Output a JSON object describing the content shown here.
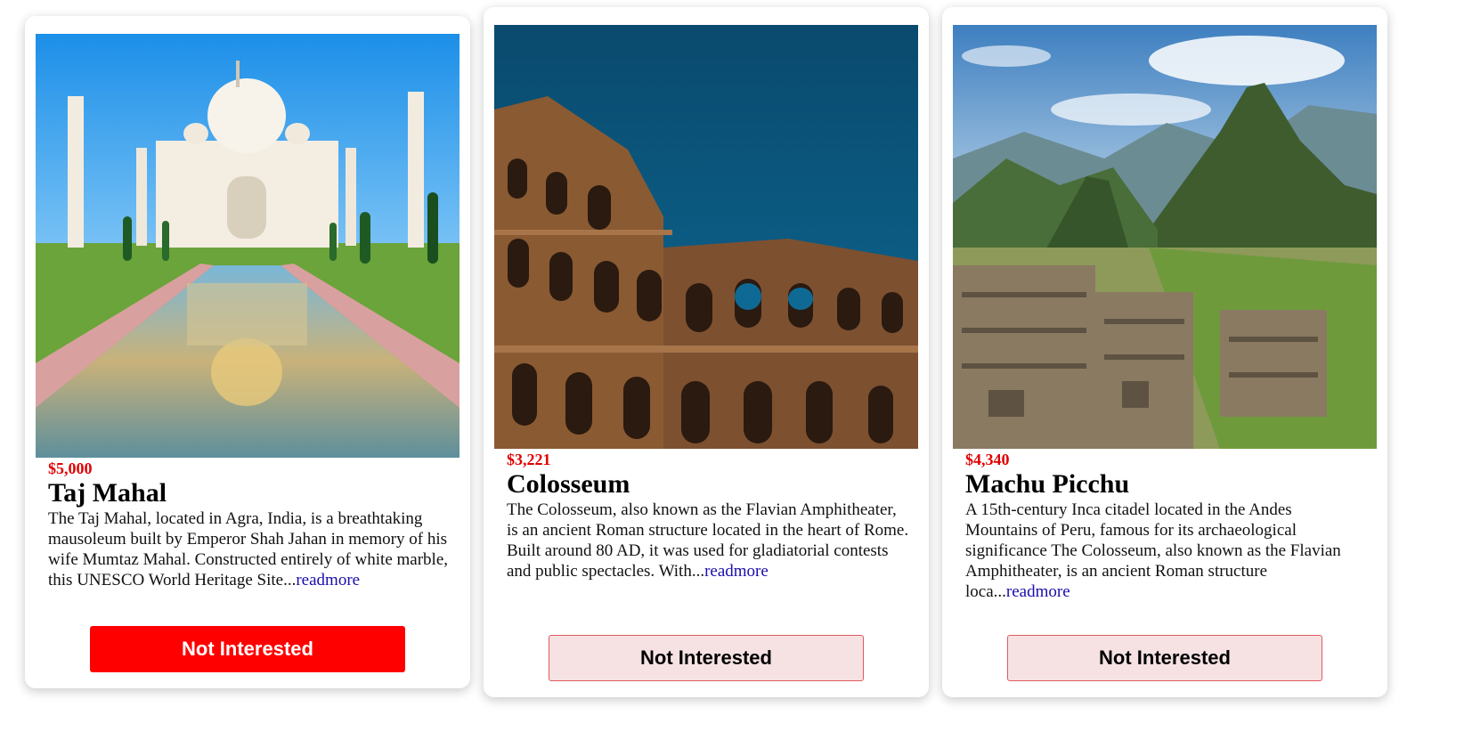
{
  "colors": {
    "price": "#e00000",
    "readmore_link": "#1a0dab",
    "button_active_bg": "#ff0000",
    "button_inactive_bg": "#f6e2e3",
    "button_inactive_border": "#e05a60"
  },
  "cards": [
    {
      "price": "$5,000",
      "title": "Taj Mahal",
      "description": "The Taj Mahal, located in Agra, India, is a breathtaking mausoleum built by Emperor Shah Jahan in memory of his wife Mumtaz Mahal. Constructed entirely of white marble, this UNESCO World Heritage Site...",
      "readmore": "readmore",
      "button": "Not Interested",
      "button_state": "active"
    },
    {
      "price": "$3,221",
      "title": "Colosseum",
      "description": "The Colosseum, also known as the Flavian Amphitheater, is an ancient Roman structure located in the heart of Rome. Built around 80 AD, it was used for gladiatorial contests and public spectacles. With...",
      "readmore": "readmore",
      "button": "Not Interested",
      "button_state": "inactive"
    },
    {
      "price": "$4,340",
      "title": "Machu Picchu",
      "description": "A 15th-century Inca citadel located in the Andes Mountains of Peru, famous for its archaeological significance The Colosseum, also known as the Flavian Amphitheater, is an ancient Roman structure loca...",
      "readmore": "readmore",
      "button": "Not Interested",
      "button_state": "inactive"
    }
  ]
}
